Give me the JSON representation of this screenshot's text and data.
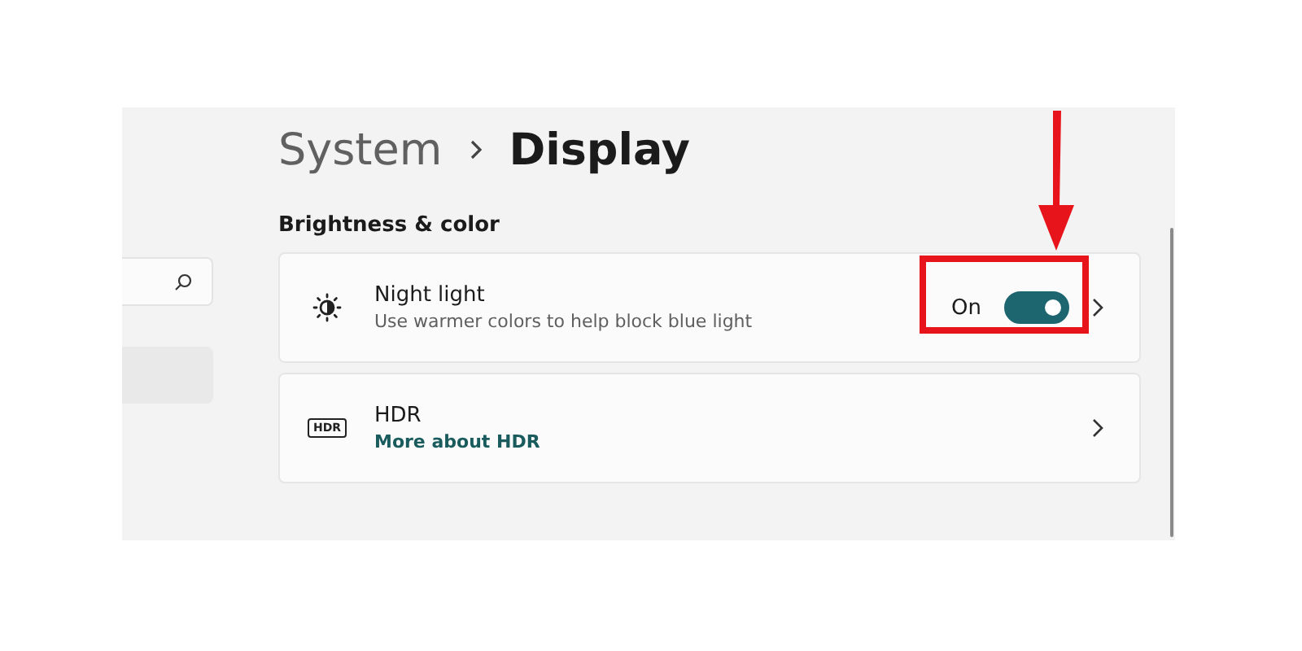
{
  "breadcrumb": {
    "parent": "System",
    "current": "Display"
  },
  "section_title": "Brightness & color",
  "settings": [
    {
      "kind": "toggle",
      "title": "Night light",
      "subtitle": "Use warmer colors to help block blue light",
      "state_label": "On",
      "on": true,
      "highlighted": true
    },
    {
      "kind": "link",
      "title": "HDR",
      "icon_text": "HDR",
      "link": "More about HDR"
    }
  ]
}
